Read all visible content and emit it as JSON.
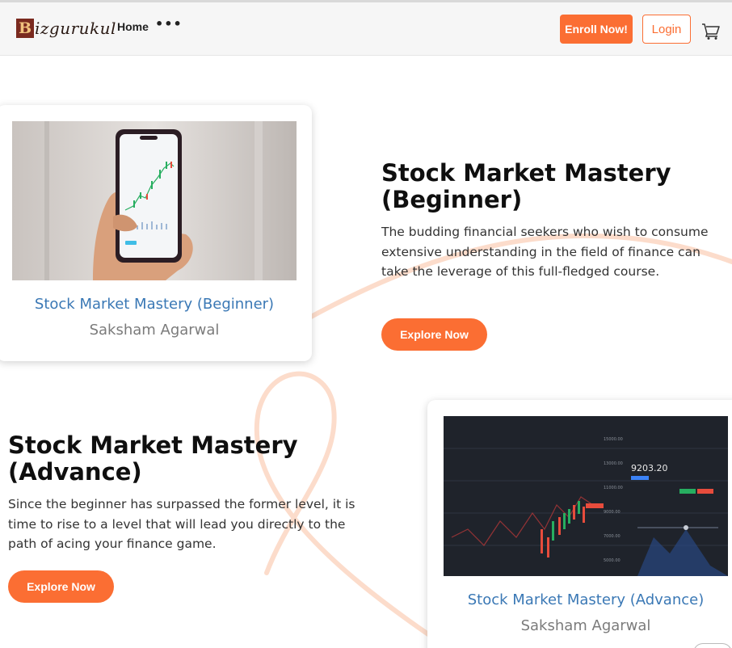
{
  "brand": {
    "logo_initial": "B",
    "logo_text": "izgurukul"
  },
  "nav": {
    "home_label": "Home",
    "more_label": "•••",
    "enroll_label": "Enroll Now!",
    "login_label": "Login"
  },
  "colors": {
    "accent": "#fb6e33",
    "link_blue": "#3a78b5",
    "author_gray": "#7b7b7b",
    "curve": "#fcdccb"
  },
  "icons": {
    "cart": "cart-icon",
    "more": "more-dots-icon"
  },
  "courses": [
    {
      "card_title": "Stock Market Mastery (Beginner)",
      "author": "Saksham Agarwal",
      "heading_line1": "Stock Market Mastery",
      "heading_line2": "(Beginner)",
      "description": "The budding financial seekers who wish to consume extensive understanding in the field of finance can take the leverage of this full-fledged course.",
      "cta_label": "Explore Now"
    },
    {
      "card_title": "Stock Market Mastery (Advance)",
      "author": "Saksham Agarwal",
      "heading_line1": "Stock Market Mastery",
      "heading_line2": "(Advance)",
      "description": "Since the beginner has surpassed the former level, it is time to rise to a level that will lead you directly to the path of acing your finance game.",
      "cta_label": "Explore Now"
    }
  ]
}
